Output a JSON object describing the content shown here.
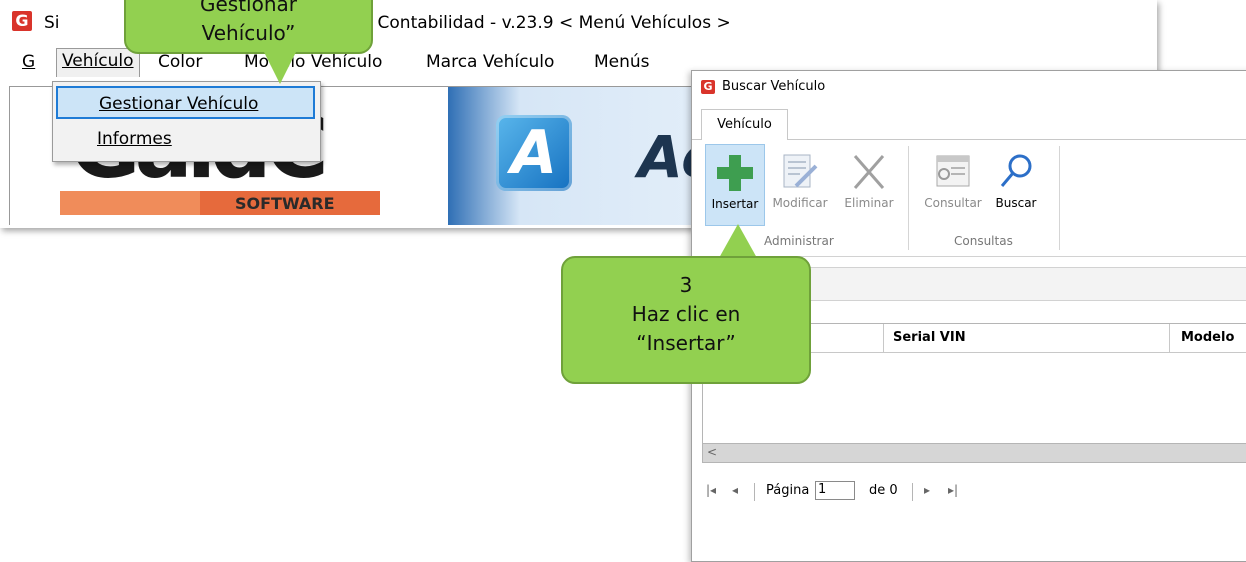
{
  "main_window": {
    "logo_letter": "G",
    "title_start": "Si",
    "title_end": "- Contabilidad - v.23.9 < Menú Vehículos >",
    "menu": {
      "g": "G",
      "vehiculo": "Vehículo",
      "color": "Color",
      "modelo": "Modelo Vehículo",
      "marca": "Marca Vehículo",
      "menus": "Menús"
    },
    "dropdown": {
      "gestionar": "Gestionar Vehículo",
      "informes": "Informes"
    },
    "brand": {
      "software_text": "SOFTWARE",
      "a_icon_letter": "A",
      "product_text": "Ac"
    }
  },
  "callout_top": {
    "line1": "Gestionar",
    "line2": "Vehículo”"
  },
  "search_window": {
    "logo_letter": "G",
    "title": "Buscar Vehículo",
    "tab": "Vehículo",
    "ribbon": {
      "insertar": "Insertar",
      "modificar": "Modificar",
      "eliminar": "Eliminar",
      "consultar": "Consultar",
      "buscar": "Buscar",
      "group_admin": "Administrar",
      "group_consultas": "Consultas"
    },
    "grid": {
      "columns": [
        "Serial VIN",
        "Modelo"
      ],
      "scroll_left": "<"
    },
    "pager": {
      "first": "|◂",
      "prev": "◂",
      "page_label": "Página",
      "page_value": "1",
      "of_label": "de 0",
      "next": "▸",
      "last": "▸|"
    }
  },
  "callout_step3": {
    "step": "3",
    "line1": "Haz clic en",
    "line2": "“Insertar”"
  },
  "colors": {
    "callout_green": "#92d050",
    "selection_blue": "#cce4f7",
    "accent_blue": "#1e7bd6",
    "logo_red": "#d9342b"
  }
}
